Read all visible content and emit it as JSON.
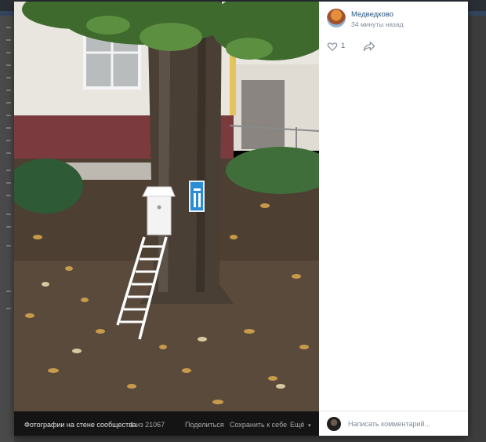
{
  "post": {
    "author_name": "Медведково",
    "time": "34 минуты назад",
    "likes": "1",
    "icons": [
      "like-icon",
      "share-icon"
    ]
  },
  "comment": {
    "placeholder": "Написать комментарий..."
  },
  "photo_bar": {
    "album_label": "Фотографии на стене сообщества",
    "counter": "1 из 21067",
    "share_label": "Поделиться",
    "save_label": "Сохранить к себе",
    "more_label": "Ещё"
  }
}
